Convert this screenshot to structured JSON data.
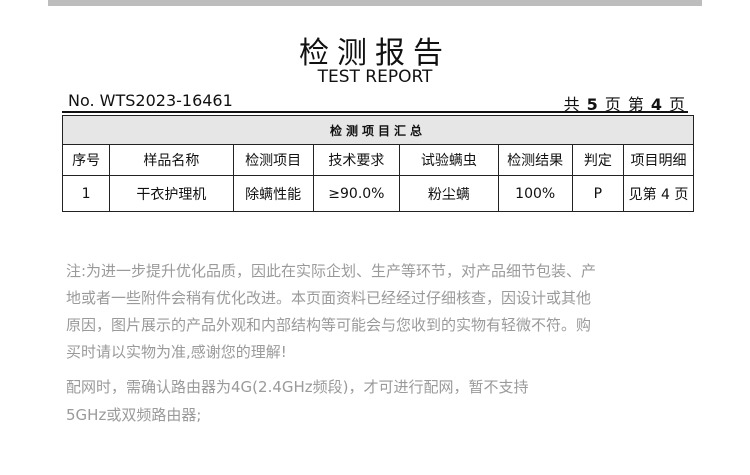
{
  "header": {
    "title_cn": "检测报告",
    "title_en": "TEST REPORT",
    "report_no": "No. WTS2023-16461",
    "page_prefix": "共",
    "page_total": "5",
    "page_mid": "页 第",
    "page_current": "4",
    "page_suffix": "页"
  },
  "table": {
    "summary_title": "检测项目汇总",
    "columns": [
      "序号",
      "样品名称",
      "检测项目",
      "技术要求",
      "试验螨虫",
      "检测结果",
      "判定",
      "项目明细"
    ],
    "rows": [
      [
        "1",
        "干衣护理机",
        "除螨性能",
        "≥90.0%",
        "粉尘螨",
        "100%",
        "P",
        "见第 4 页"
      ]
    ]
  },
  "notes": {
    "line1": "注:为进一步提升优化品质，因此在实际企划、生产等环节，对产品细节包装、产",
    "line2": "地或者一些附件会稍有优化改进。本页面资料已经经过仔细核查，因设计或其他",
    "line3": "原因，图片展示的产品外观和内部结构等可能会与您收到的实物有轻微不符。购",
    "line4": "买时请以实物为准,感谢您的理解!",
    "network1": "配网时，需确认路由器为4G(2.4GHz频段)，才可进行配网，暂不支持",
    "network2": "5GHz或双频路由器;"
  }
}
